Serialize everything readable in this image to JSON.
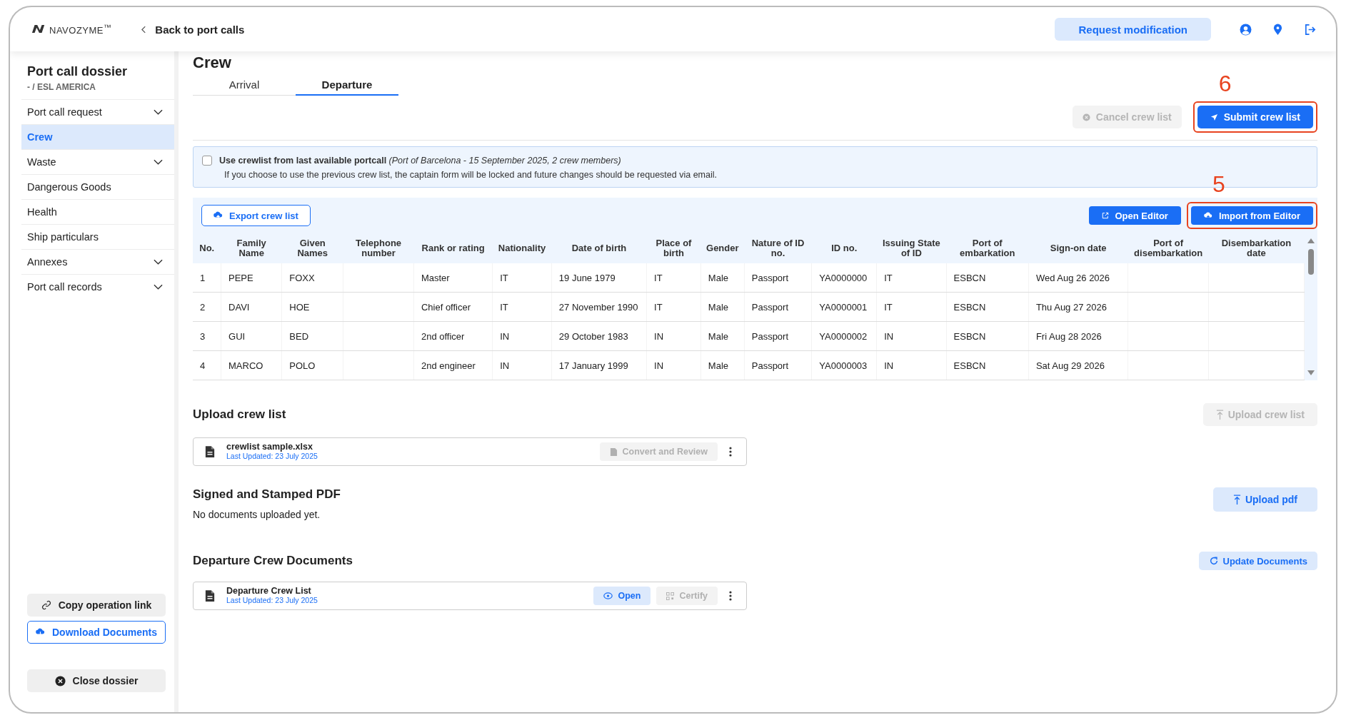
{
  "header": {
    "brand": "NAVOZYME$^{™}$",
    "back_link": "Back to port calls",
    "request_button": "Request modification"
  },
  "sidebar": {
    "title": "Port call dossier",
    "subtitle": "- / ESL AMERICA",
    "items": [
      {
        "label": "Port call request",
        "expandable": true,
        "selected": false
      },
      {
        "label": "Crew",
        "expandable": false,
        "selected": true
      },
      {
        "label": "Waste",
        "expandable": true,
        "selected": false
      },
      {
        "label": "Dangerous Goods",
        "expandable": false,
        "selected": false
      },
      {
        "label": "Health",
        "expandable": false,
        "selected": false
      },
      {
        "label": "Ship particulars",
        "expandable": false,
        "selected": false
      },
      {
        "label": "Annexes",
        "expandable": true,
        "selected": false
      },
      {
        "label": "Port call records",
        "expandable": true,
        "selected": false
      }
    ],
    "buttons": [
      {
        "label": "Copy operation link",
        "kind": "link"
      },
      {
        "label": "Download Documents",
        "kind": "download"
      }
    ],
    "close_button": "Close dossier"
  },
  "page_title": "Crew",
  "tabs": [
    {
      "label": "Arrival",
      "selected": false
    },
    {
      "label": "Departure",
      "selected": true
    }
  ],
  "actions": [
    {
      "label": "Cancel crew list",
      "kind": "cancel",
      "disabled": true
    },
    {
      "label": "Submit crew list",
      "kind": "submit",
      "disabled": false,
      "callout": "6"
    }
  ],
  "notice": {
    "checked": false,
    "label": "**Use crewlist from last available portcall** *(Port of Barcelona - 15 September 2025, 2 crew members)*",
    "text": "If you choose to use the previous crew list, the captain form will be locked and future changes should be requested via email."
  },
  "table_toolbar": {
    "export": "Export crew list",
    "editor_buttons": [
      {
        "label": "Open Editor",
        "kind": "open"
      },
      {
        "label": "Import from Editor",
        "kind": "import",
        "callout": "5"
      }
    ]
  },
  "table": {
    "columns": [
      "No.",
      "Family Name",
      "Given Names",
      "Telephone number",
      "Rank or rating",
      "Nationality",
      "Date of birth",
      "Place of birth",
      "Gender",
      "Nature of ID no.",
      "ID no.",
      "Issuing State of ID",
      "Port of embarkation",
      "Sign-on date",
      "Port of disembarkation",
      "Disembarkation date"
    ],
    "rows": [
      {
        "cells": [
          "1",
          "PEPE",
          "FOXX",
          null,
          "Master",
          "IT",
          "19 June 1979",
          "IT",
          "Male",
          "Passport",
          "YA0000000",
          "IT",
          "ESBCN",
          "Wed Aug 26 2026",
          null,
          null
        ]
      },
      {
        "cells": [
          "2",
          "DAVI",
          "HOE",
          null,
          "Chief officer",
          "IT",
          "27 November 1990",
          "IT",
          "Male",
          "Passport",
          "YA0000001",
          "IT",
          "ESBCN",
          "Thu Aug 27 2026",
          null,
          null
        ]
      },
      {
        "cells": [
          "3",
          "GUI",
          "BED",
          null,
          "2nd officer",
          "IN",
          "29 October 1983",
          "IN",
          "Male",
          "Passport",
          "YA0000002",
          "IN",
          "ESBCN",
          "Fri Aug 28 2026",
          null,
          null
        ]
      },
      {
        "cells": [
          "4",
          "MARCO",
          "POLO",
          null,
          "2nd engineer",
          "IN",
          "17 January 1999",
          "IN",
          "Male",
          "Passport",
          "YA0000003",
          "IN",
          "ESBCN",
          "Sat Aug 29 2026",
          null,
          null
        ]
      }
    ]
  },
  "upload": {
    "title": "Upload crew list",
    "button": {
      "label": "Upload crew list",
      "disabled": true
    },
    "file": {
      "name": "crewlist sample.xlsx",
      "updated": "Last Updated: 23 July 2025",
      "actions": [
        {
          "label": "Convert and Review",
          "kind": "convert",
          "disabled": true
        }
      ]
    }
  },
  "signed": {
    "title": "Signed and Stamped PDF",
    "empty": "No documents uploaded yet.",
    "button": {
      "label": "Upload pdf",
      "disabled": false
    }
  },
  "documents": {
    "title": "Departure Crew Documents",
    "button": "Update Documents",
    "file": {
      "name": "Departure Crew List",
      "updated": "Last Updated: 23 July 2025",
      "actions": [
        {
          "label": "Open",
          "kind": "open",
          "disabled": false
        },
        {
          "label": "Certify",
          "kind": "certify",
          "disabled": true
        }
      ]
    }
  }
}
